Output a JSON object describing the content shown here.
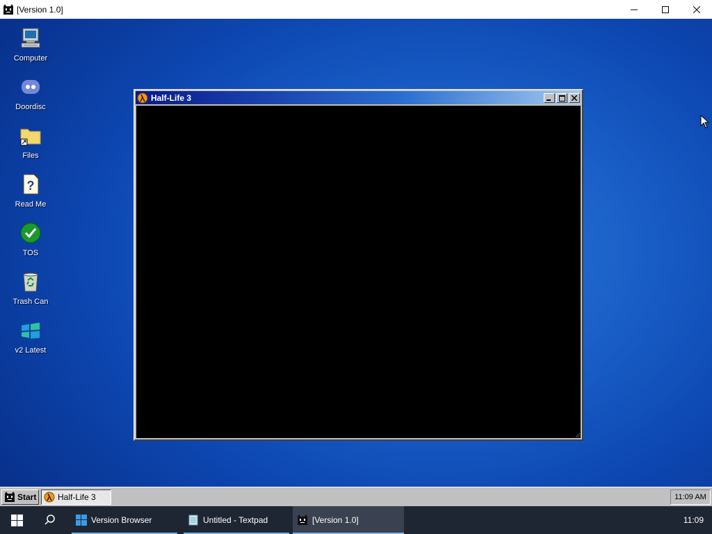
{
  "host_window": {
    "title": "[Version 1.0]",
    "controls": [
      "minimize",
      "maximize",
      "close"
    ]
  },
  "desktop": {
    "icons": [
      {
        "label": "Computer",
        "icon": "computer-icon"
      },
      {
        "label": "Doordisc",
        "icon": "doordisc-icon"
      },
      {
        "label": "Files",
        "icon": "folder-shortcut-icon"
      },
      {
        "label": "Read Me",
        "icon": "help-document-icon"
      },
      {
        "label": "TOS",
        "icon": "checkmark-icon"
      },
      {
        "label": "Trash Can",
        "icon": "recycle-bin-icon"
      },
      {
        "label": "v2 Latest",
        "icon": "windows-logo-icon"
      }
    ]
  },
  "game_window": {
    "title": "Half-Life 3",
    "icon": "half-life-lambda-icon",
    "body_color": "#000000"
  },
  "retro_taskbar": {
    "start_label": "Start",
    "active_task": "Half-Life 3",
    "clock": "11:09 AM"
  },
  "host_taskbar": {
    "apps": [
      {
        "label": "Version Browser",
        "icon": "windows-logo-icon"
      },
      {
        "label": "Untitled - Textpad",
        "icon": "notepad-icon"
      },
      {
        "label": "[Version 1.0]",
        "icon": "cat-face-icon"
      }
    ],
    "clock": "11:09"
  },
  "colors": {
    "desktop_blue": "#1a60c8",
    "title_gradient_start": "#0a1a8a",
    "accent_underline": "#76b9ed"
  }
}
